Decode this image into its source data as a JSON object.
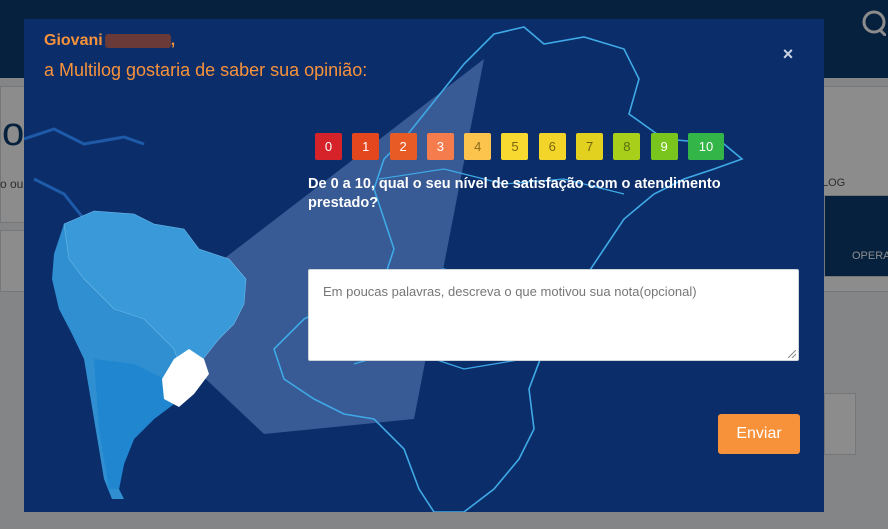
{
  "background": {
    "fragments": [
      "o",
      "o ou",
      "LOG",
      "OPERA"
    ]
  },
  "modal": {
    "greeting_name": "Giovani",
    "greeting_suffix": ",",
    "greeting_subtitle": "a Multilog gostaria de saber sua opinião:",
    "close_label": "×",
    "scale": [
      {
        "label": "0",
        "color": "#d6232a",
        "text_color": "#ffffff"
      },
      {
        "label": "1",
        "color": "#e4471e",
        "text_color": "#ffffff"
      },
      {
        "label": "2",
        "color": "#e85b24",
        "text_color": "#ffffff"
      },
      {
        "label": "3",
        "color": "#f47c4d",
        "text_color": "#ffffff"
      },
      {
        "label": "4",
        "color": "#fcc44d",
        "text_color": "#8a6d1a"
      },
      {
        "label": "5",
        "color": "#f8d92f",
        "text_color": "#7a6512"
      },
      {
        "label": "6",
        "color": "#f3d52a",
        "text_color": "#7a6512"
      },
      {
        "label": "7",
        "color": "#e3d11f",
        "text_color": "#6e6410"
      },
      {
        "label": "8",
        "color": "#a8cf1a",
        "text_color": "#5a6d0e"
      },
      {
        "label": "9",
        "color": "#79c51d",
        "text_color": "#ffffff"
      },
      {
        "label": "10",
        "color": "#33b547",
        "text_color": "#ffffff"
      }
    ],
    "question": "De 0 a 10, qual o seu nível de satisfação com o atendimento prestado?",
    "textarea_placeholder": "Em poucas palavras, descreva o que motivou sua nota(opcional)",
    "submit_label": "Enviar"
  }
}
